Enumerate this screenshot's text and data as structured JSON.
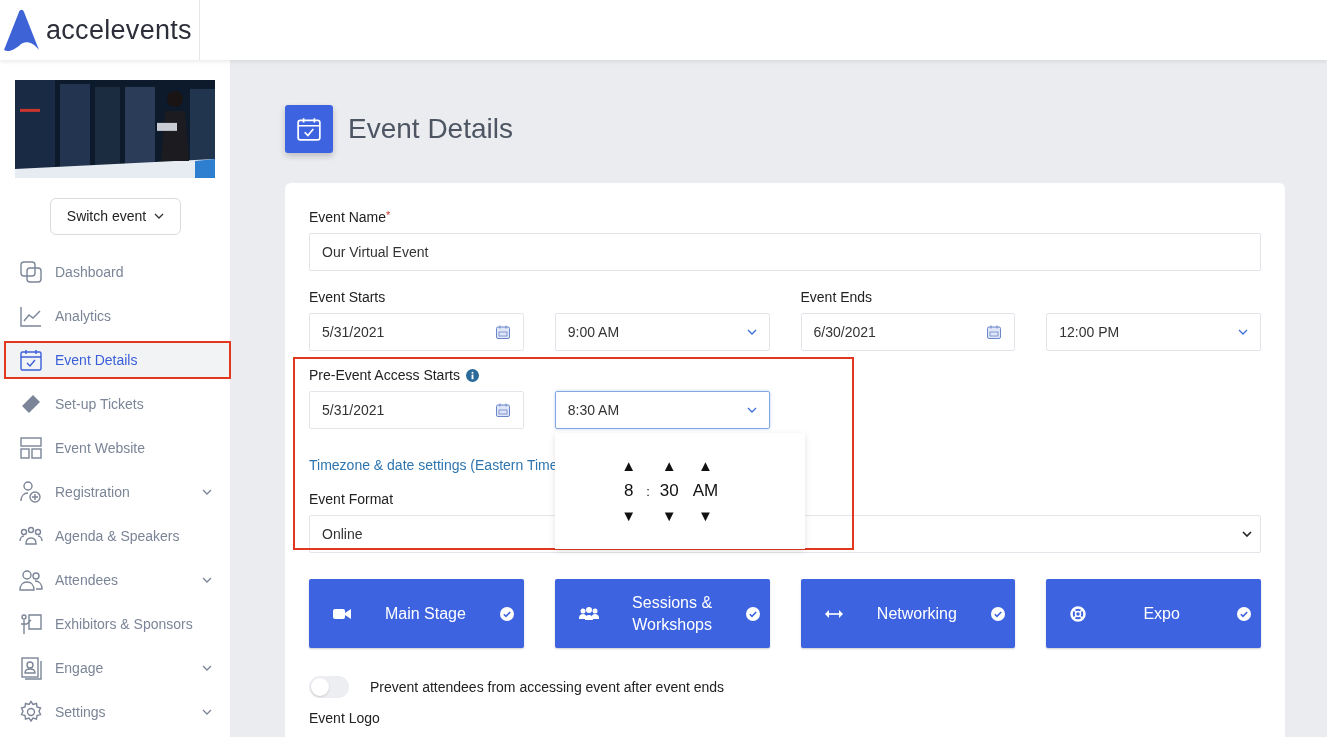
{
  "brand": {
    "name": "accelevents"
  },
  "sidebar": {
    "switch_event": "Switch event",
    "items": [
      {
        "label": "Dashboard",
        "selected": false,
        "expandable": false,
        "highlighted": false
      },
      {
        "label": "Analytics",
        "selected": false,
        "expandable": false,
        "highlighted": false
      },
      {
        "label": "Event Details",
        "selected": true,
        "expandable": false,
        "highlighted": true
      },
      {
        "label": "Set-up Tickets",
        "selected": false,
        "expandable": false,
        "highlighted": false
      },
      {
        "label": "Event Website",
        "selected": false,
        "expandable": false,
        "highlighted": false
      },
      {
        "label": "Registration",
        "selected": false,
        "expandable": true,
        "highlighted": false
      },
      {
        "label": "Agenda & Speakers",
        "selected": false,
        "expandable": false,
        "highlighted": false
      },
      {
        "label": "Attendees",
        "selected": false,
        "expandable": true,
        "highlighted": false
      },
      {
        "label": "Exhibitors & Sponsors",
        "selected": false,
        "expandable": false,
        "highlighted": false
      },
      {
        "label": "Engage",
        "selected": false,
        "expandable": true,
        "highlighted": false
      },
      {
        "label": "Settings",
        "selected": false,
        "expandable": true,
        "highlighted": false
      }
    ]
  },
  "page": {
    "title": "Event Details"
  },
  "form": {
    "event_name": {
      "label": "Event Name",
      "required": true,
      "required_mark": "*",
      "value": "Our Virtual Event"
    },
    "event_starts": {
      "label": "Event Starts",
      "date": "5/31/2021",
      "time": "9:00 AM"
    },
    "event_ends": {
      "label": "Event Ends",
      "date": "6/30/2021",
      "time": "12:00 PM"
    },
    "pre_event": {
      "label": "Pre-Event Access Starts",
      "date": "5/31/2021",
      "time": "8:30 AM",
      "time_open": true,
      "highlighted": true
    },
    "time_picker": {
      "up_arrow": "▲",
      "down_arrow": "▼",
      "hour": "8",
      "separator": ":",
      "minute": "30",
      "period": "AM"
    },
    "timezone_link": "Timezone & date settings (Eastern Time",
    "event_format": {
      "label": "Event Format",
      "value": "Online"
    },
    "formats": [
      {
        "label": "Main Stage",
        "selected": true
      },
      {
        "label": "Sessions & Workshops",
        "selected": true
      },
      {
        "label": "Networking",
        "selected": true
      },
      {
        "label": "Expo",
        "selected": true
      }
    ],
    "prevent_access": {
      "label": "Prevent attendees from accessing event after event ends",
      "on": false
    },
    "event_logo_label": "Event Logo"
  }
}
